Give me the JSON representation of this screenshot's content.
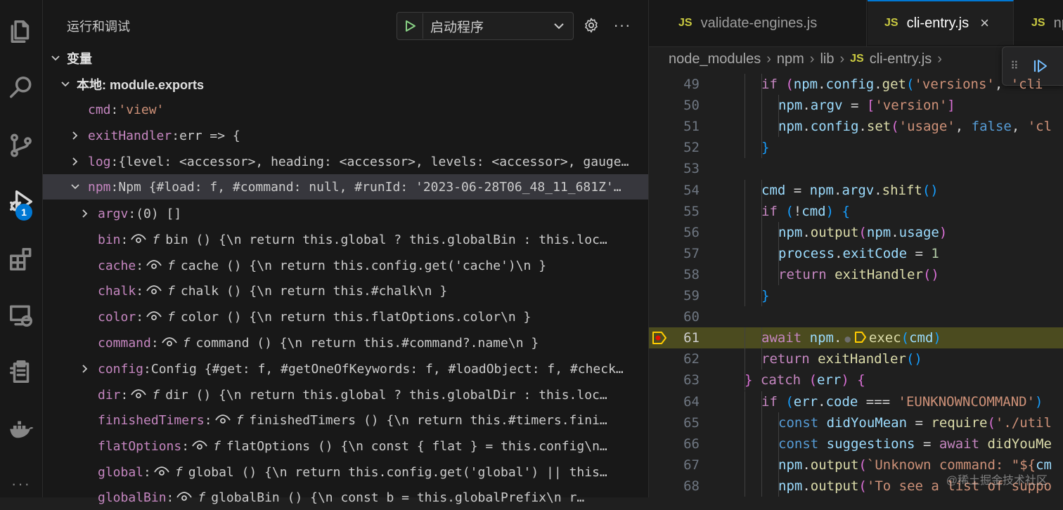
{
  "activity_bar": {
    "items": [
      "explorer-icon",
      "search-icon",
      "source-control-icon",
      "run-debug-icon",
      "extensions-icon",
      "remote-explorer-icon",
      "testing-icon",
      "docker-icon",
      "more-icon"
    ],
    "debug_badge": "1"
  },
  "sidebar": {
    "title": "运行和调试",
    "launch_config": "启动程序",
    "more": "···",
    "variables_header": "变量",
    "scope_label": "本地: module.exports",
    "vars": [
      {
        "key": "cmd",
        "sep": ": ",
        "value": "'view'",
        "expand": "none"
      },
      {
        "key": "exitHandler",
        "sep": ": ",
        "value": "err => {",
        "expand": "collapsed"
      },
      {
        "key": "log",
        "sep": ": ",
        "value": "{level: <accessor>, heading: <accessor>, levels: <accessor>, gauge…",
        "expand": "collapsed"
      },
      {
        "key": "npm",
        "sep": ": ",
        "value": "Npm {#load: f, #command: null, #runId: '2023-06-28T06_48_11_681Z'…",
        "expand": "expanded"
      }
    ],
    "npm_children": [
      {
        "key": "argv",
        "sep": ": ",
        "value": "(0) []",
        "expand": "collapsed",
        "getter": false
      },
      {
        "key": "bin",
        "sep": ":",
        "fn": "f",
        "value": "bin () {\\n    return this.global ? this.globalBin : this.loc…",
        "getter": true
      },
      {
        "key": "cache",
        "sep": ":",
        "fn": "f",
        "value": "cache () {\\n    return this.config.get('cache')\\n  }",
        "getter": true
      },
      {
        "key": "chalk",
        "sep": ":",
        "fn": "f",
        "value": "chalk () {\\n    return this.#chalk\\n  }",
        "getter": true
      },
      {
        "key": "color",
        "sep": ":",
        "fn": "f",
        "value": "color () {\\n    return this.flatOptions.color\\n  }",
        "getter": true
      },
      {
        "key": "command",
        "sep": ":",
        "fn": "f",
        "value": "command () {\\n    return this.#command?.name\\n  }",
        "getter": true
      },
      {
        "key": "config",
        "sep": ": ",
        "value": "Config {#get: f, #getOneOfKeywords: f, #loadObject: f, #check…",
        "expand": "collapsed",
        "getter": false
      },
      {
        "key": "dir",
        "sep": ":",
        "fn": "f",
        "value": "dir () {\\n    return this.global ? this.globalDir : this.loc…",
        "getter": true
      },
      {
        "key": "finishedTimers",
        "sep": ":",
        "fn": "f",
        "value": "finishedTimers () {\\n    return this.#timers.fini…",
        "getter": true
      },
      {
        "key": "flatOptions",
        "sep": ":",
        "fn": "f",
        "value": "flatOptions () {\\n    const { flat } = this.config\\n…",
        "getter": true
      },
      {
        "key": "global",
        "sep": ":",
        "fn": "f",
        "value": "global () {\\n    return this.config.get('global') || this…",
        "getter": true
      },
      {
        "key": "globalBin",
        "sep": ":",
        "fn": "f",
        "value": "globalBin () {\\n    const b = this.globalPrefix\\n    r…",
        "getter": true
      }
    ]
  },
  "editor": {
    "tabs": [
      {
        "label": "validate-engines.js",
        "icon": "JS",
        "active": false
      },
      {
        "label": "cli-entry.js",
        "icon": "JS",
        "active": true,
        "close": "×"
      },
      {
        "label": "np",
        "icon": "JS",
        "active": false
      }
    ],
    "breadcrumb": [
      "node_modules",
      "npm",
      "lib",
      "cli-entry.js"
    ],
    "breadcrumb_icon": "JS",
    "lines": [
      {
        "n": "49",
        "indent": 2,
        "tokens": [
          [
            "kw",
            "if"
          ],
          [
            "pl",
            " "
          ],
          [
            "br2",
            "("
          ],
          [
            "id",
            "npm"
          ],
          [
            "pl",
            "."
          ],
          [
            "id",
            "config"
          ],
          [
            "pl",
            "."
          ],
          [
            "fn",
            "get"
          ],
          [
            "br3",
            "("
          ],
          [
            "st",
            "'versions'"
          ],
          [
            "pl",
            ", "
          ],
          [
            "st",
            "'cli"
          ]
        ]
      },
      {
        "n": "50",
        "indent": 3,
        "tokens": [
          [
            "id",
            "npm"
          ],
          [
            "pl",
            "."
          ],
          [
            "id",
            "argv"
          ],
          [
            "pl",
            " = "
          ],
          [
            "br2",
            "["
          ],
          [
            "st",
            "'version'"
          ],
          [
            "br2",
            "]"
          ]
        ]
      },
      {
        "n": "51",
        "indent": 3,
        "tokens": [
          [
            "id",
            "npm"
          ],
          [
            "pl",
            "."
          ],
          [
            "id",
            "config"
          ],
          [
            "pl",
            "."
          ],
          [
            "fn",
            "set"
          ],
          [
            "br2",
            "("
          ],
          [
            "st",
            "'usage'"
          ],
          [
            "pl",
            ", "
          ],
          [
            "kb",
            "false"
          ],
          [
            "pl",
            ", "
          ],
          [
            "st",
            "'cl"
          ]
        ]
      },
      {
        "n": "52",
        "indent": 2,
        "tokens": [
          [
            "br3",
            "}"
          ]
        ]
      },
      {
        "n": "53",
        "indent": 0,
        "tokens": []
      },
      {
        "n": "54",
        "indent": 2,
        "tokens": [
          [
            "id",
            "cmd"
          ],
          [
            "pl",
            " = "
          ],
          [
            "id",
            "npm"
          ],
          [
            "pl",
            "."
          ],
          [
            "id",
            "argv"
          ],
          [
            "pl",
            "."
          ],
          [
            "fn",
            "shift"
          ],
          [
            "br3",
            "()"
          ]
        ]
      },
      {
        "n": "55",
        "indent": 2,
        "tokens": [
          [
            "kw",
            "if"
          ],
          [
            "pl",
            " "
          ],
          [
            "br3",
            "("
          ],
          [
            "pl",
            "!"
          ],
          [
            "id",
            "cmd"
          ],
          [
            "br3",
            ")"
          ],
          [
            "pl",
            " "
          ],
          [
            "br3",
            "{"
          ]
        ]
      },
      {
        "n": "56",
        "indent": 3,
        "tokens": [
          [
            "id",
            "npm"
          ],
          [
            "pl",
            "."
          ],
          [
            "fn",
            "output"
          ],
          [
            "br2",
            "("
          ],
          [
            "id",
            "npm"
          ],
          [
            "pl",
            "."
          ],
          [
            "id",
            "usage"
          ],
          [
            "br2",
            ")"
          ]
        ]
      },
      {
        "n": "57",
        "indent": 3,
        "tokens": [
          [
            "id",
            "process"
          ],
          [
            "pl",
            "."
          ],
          [
            "id",
            "exitCode"
          ],
          [
            "pl",
            " = "
          ],
          [
            "nm",
            "1"
          ]
        ]
      },
      {
        "n": "58",
        "indent": 3,
        "tokens": [
          [
            "kw",
            "return"
          ],
          [
            "pl",
            " "
          ],
          [
            "fn",
            "exitHandler"
          ],
          [
            "br2",
            "()"
          ]
        ]
      },
      {
        "n": "59",
        "indent": 2,
        "tokens": [
          [
            "br3",
            "}"
          ]
        ]
      },
      {
        "n": "60",
        "indent": 0,
        "tokens": []
      },
      {
        "n": "61",
        "indent": 2,
        "current": true,
        "tokens": [
          [
            "kw",
            "await"
          ],
          [
            "pl",
            " "
          ],
          [
            "id",
            "npm"
          ],
          [
            "pl",
            "."
          ],
          [
            "dot",
            "●"
          ],
          [
            "arrow",
            ""
          ],
          [
            "fn",
            "exec"
          ],
          [
            "br3",
            "("
          ],
          [
            "id",
            "cmd"
          ],
          [
            "br3",
            ")"
          ]
        ]
      },
      {
        "n": "62",
        "indent": 2,
        "tokens": [
          [
            "kw",
            "return"
          ],
          [
            "pl",
            " "
          ],
          [
            "fn",
            "exitHandler"
          ],
          [
            "br3",
            "()"
          ]
        ]
      },
      {
        "n": "63",
        "indent": 1,
        "tokens": [
          [
            "br2",
            "}"
          ],
          [
            "pl",
            " "
          ],
          [
            "kw",
            "catch"
          ],
          [
            "pl",
            " "
          ],
          [
            "br2",
            "("
          ],
          [
            "id",
            "err"
          ],
          [
            "br2",
            ")"
          ],
          [
            "pl",
            " "
          ],
          [
            "br2",
            "{"
          ]
        ]
      },
      {
        "n": "64",
        "indent": 2,
        "tokens": [
          [
            "kw",
            "if"
          ],
          [
            "pl",
            " "
          ],
          [
            "br3",
            "("
          ],
          [
            "id",
            "err"
          ],
          [
            "pl",
            "."
          ],
          [
            "id",
            "code"
          ],
          [
            "pl",
            " === "
          ],
          [
            "st",
            "'EUNKNOWNCOMMAND'"
          ],
          [
            "br3",
            ")"
          ]
        ]
      },
      {
        "n": "65",
        "indent": 3,
        "tokens": [
          [
            "kb",
            "const"
          ],
          [
            "pl",
            " "
          ],
          [
            "id",
            "didYouMean"
          ],
          [
            "pl",
            " = "
          ],
          [
            "fn",
            "require"
          ],
          [
            "br2",
            "("
          ],
          [
            "st",
            "'./util"
          ]
        ]
      },
      {
        "n": "66",
        "indent": 3,
        "tokens": [
          [
            "kb",
            "const"
          ],
          [
            "pl",
            " "
          ],
          [
            "id",
            "suggestions"
          ],
          [
            "pl",
            " = "
          ],
          [
            "kw",
            "await"
          ],
          [
            "pl",
            " "
          ],
          [
            "fn",
            "didYouMe"
          ]
        ]
      },
      {
        "n": "67",
        "indent": 3,
        "tokens": [
          [
            "id",
            "npm"
          ],
          [
            "pl",
            "."
          ],
          [
            "fn",
            "output"
          ],
          [
            "br2",
            "("
          ],
          [
            "st",
            "`Unknown command: \"${"
          ],
          [
            "id",
            "cm"
          ]
        ]
      },
      {
        "n": "68",
        "indent": 3,
        "tokens": [
          [
            "id",
            "npm"
          ],
          [
            "pl",
            "."
          ],
          [
            "fn",
            "output"
          ],
          [
            "br2",
            "("
          ],
          [
            "st",
            "'To see a list of suppo"
          ]
        ]
      }
    ]
  },
  "watermark": "@稀土掘金技术社区"
}
